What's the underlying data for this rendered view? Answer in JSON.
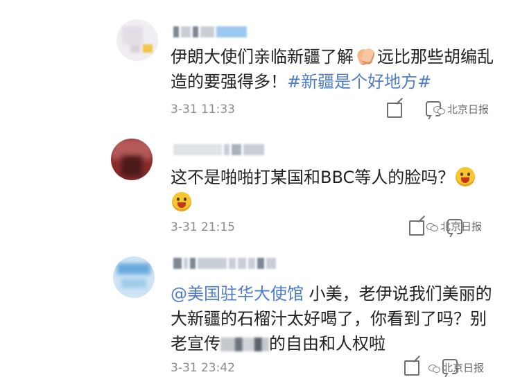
{
  "comments": [
    {
      "lines": [
        {
          "segments": [
            {
              "type": "text",
              "text": "伊朗大使们亲临新疆了解"
            },
            {
              "type": "clap-emoji"
            },
            {
              "type": "text",
              "text": "远比那些胡编乱"
            }
          ]
        },
        {
          "segments": [
            {
              "type": "text",
              "text": "造的要强得多！"
            },
            {
              "type": "tag",
              "text": "#新疆是个好地方#"
            }
          ]
        }
      ],
      "time": "3-31 11:33",
      "watermark": "北京日报"
    },
    {
      "lines": [
        {
          "segments": [
            {
              "type": "text",
              "text": "这不是啪啪打某国和BBC等人的脸吗？"
            },
            {
              "type": "laugh-emoji"
            }
          ]
        },
        {
          "segments": [
            {
              "type": "laugh-emoji"
            }
          ]
        }
      ],
      "time": "3-31 21:15",
      "watermark": "北京日报"
    },
    {
      "lines": [
        {
          "segments": [
            {
              "type": "mention",
              "text": "@美国驻华大使馆"
            },
            {
              "type": "text",
              "text": " 小美，老伊说我们美丽的"
            }
          ]
        },
        {
          "segments": [
            {
              "type": "text",
              "text": "大新疆的石榴汁太好喝了，你看到了吗？别"
            }
          ]
        },
        {
          "segments": [
            {
              "type": "text",
              "text": "老宣传"
            },
            {
              "type": "blurred"
            },
            {
              "type": "text",
              "text": "的自由和人权啦"
            }
          ]
        }
      ],
      "time": "3-31 23:42",
      "watermark": "北京日报"
    }
  ],
  "icons": {
    "share": "share-icon",
    "comment": "comment-icon",
    "watermark_logo": "wechat-logo-icon"
  },
  "colors": {
    "link": "#4f7cc9",
    "text": "#222222",
    "meta": "#8a8a8a"
  }
}
